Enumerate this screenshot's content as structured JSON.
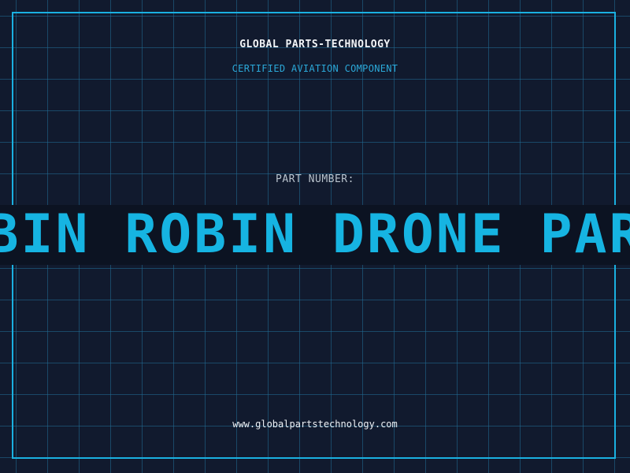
{
  "header": {
    "company": "GLOBAL PARTS-TECHNOLOGY",
    "subtitle": "CERTIFIED AVIATION COMPONENT"
  },
  "part": {
    "label": "PART NUMBER:",
    "value": "ROBIN ROBIN DRONE PARTS"
  },
  "footer": {
    "website": "www.globalpartstechnology.com"
  },
  "colors": {
    "background": "#111a2e",
    "accent": "#1ab0e0",
    "band": "#0c1322"
  }
}
